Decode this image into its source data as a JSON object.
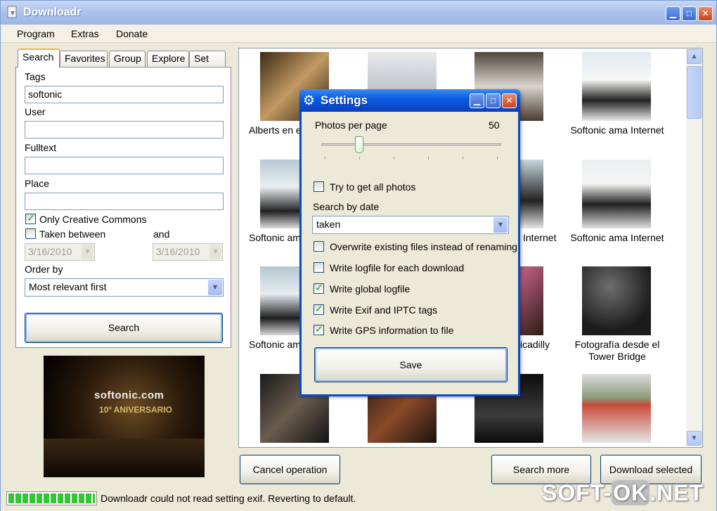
{
  "window": {
    "title": "Downloadr"
  },
  "menu": [
    "Program",
    "Extras",
    "Donate"
  ],
  "tabs": [
    "Search",
    "Favorites",
    "Group",
    "Explore",
    "Set"
  ],
  "search": {
    "tags_label": "Tags",
    "tags_value": "softonic",
    "user_label": "User",
    "user_value": "",
    "fulltext_label": "Fulltext",
    "fulltext_value": "",
    "place_label": "Place",
    "place_value": "",
    "creative_commons_label": "Only Creative Commons",
    "creative_commons_checked": true,
    "taken_between_label": "Taken between",
    "taken_between_checked": false,
    "and_label": "and",
    "date_from": "3/16/2010",
    "date_to": "3/16/2010",
    "order_label": "Order by",
    "order_value": "Most relevant first",
    "search_button": "Search"
  },
  "preview": {
    "sign": "softonic.com",
    "sign2": "10º ANIVERSARIO"
  },
  "gallery": {
    "captions": {
      "r1c1": "Alberts en e",
      "r1c4": "Softonic ama Internet",
      "r2c1": "Softonic am",
      "r2c3": "Internet",
      "r2c4": "Softonic ama Internet",
      "r3c1": "Softonic am",
      "r3c3": "icadilly",
      "r3c4": "Fotografía desde el Tower Bridge"
    }
  },
  "buttons": {
    "cancel": "Cancel operation",
    "search_more": "Search more",
    "download_selected": "Download selected"
  },
  "status": {
    "text": "Downloadr could not read setting exif. Reverting to default.",
    "progress": 1.0
  },
  "watermark": "SOFT-OK.NET",
  "settings": {
    "title": "Settings",
    "photos_per_page_label": "Photos per page",
    "photos_per_page_value": "50",
    "slider_fraction": 0.2,
    "try_all_label": "Try to get all photos",
    "try_all_checked": false,
    "search_by_date_label": "Search by date",
    "search_by_date_value": "taken",
    "overwrite_label": "Overwrite existing files instead of renaming",
    "overwrite_checked": false,
    "logfile_each_label": "Write logfile for each download",
    "logfile_each_checked": false,
    "global_logfile_label": "Write global logfile",
    "global_logfile_checked": true,
    "exif_label": "Write Exif and IPTC tags",
    "exif_checked": true,
    "gps_label": "Write GPS information to file",
    "gps_checked": true,
    "save_button": "Save"
  },
  "colors": {
    "title_blue": "#0a5ee0",
    "check_green": "#21a121",
    "progress_green": "#35c435"
  }
}
